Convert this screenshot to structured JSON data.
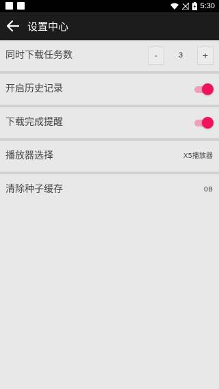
{
  "status_bar": {
    "time": "5:30"
  },
  "toolbar": {
    "title": "设置中心",
    "back_icon": "arrow-back-icon"
  },
  "settings": {
    "concurrent_downloads": {
      "label": "同时下载任务数",
      "minus": "-",
      "plus": "+",
      "value": "3"
    },
    "history": {
      "label": "开启历史记录",
      "enabled": true
    },
    "download_notify": {
      "label": "下载完成提醒",
      "enabled": true
    },
    "player": {
      "label": "播放器选择",
      "value": "X5播放器"
    },
    "clear_cache": {
      "label": "清除种子缓存",
      "value": "0B"
    }
  },
  "colors": {
    "accent": "#f0125f",
    "toolbar": "#1c1c1c",
    "background": "#e8e8e8"
  }
}
